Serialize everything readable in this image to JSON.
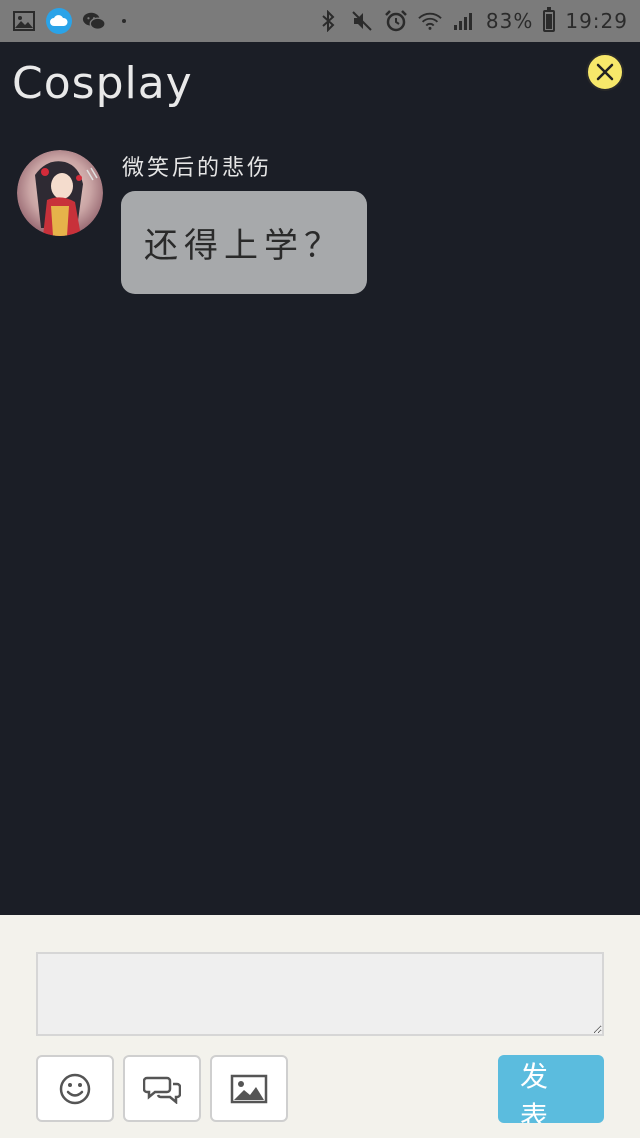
{
  "status_bar": {
    "left_icons": [
      "gallery-icon",
      "cloud-icon",
      "wechat-icon",
      "dot-icon"
    ],
    "right_icons": [
      "bluetooth-icon",
      "mute-icon",
      "alarm-icon",
      "wifi-icon",
      "signal-icon",
      "battery-icon"
    ],
    "battery_percent": "83%",
    "battery_level": 0.83,
    "time": "19:29"
  },
  "header": {
    "title": "Cosplay",
    "close_icon": "close-icon",
    "close_color": "#f7e86a"
  },
  "messages": [
    {
      "sender": "微笑后的悲伤",
      "text": "还得上学？",
      "avatar": "avatar-image"
    }
  ],
  "composer": {
    "input_value": "",
    "tools": [
      "emoji-icon",
      "chat-icon",
      "image-icon"
    ],
    "send_label": "发表",
    "send_color": "#5bbcde"
  },
  "colors": {
    "background": "#1b1e26",
    "bubble": "#a7a9ab",
    "composer": "#f3f2ec"
  }
}
